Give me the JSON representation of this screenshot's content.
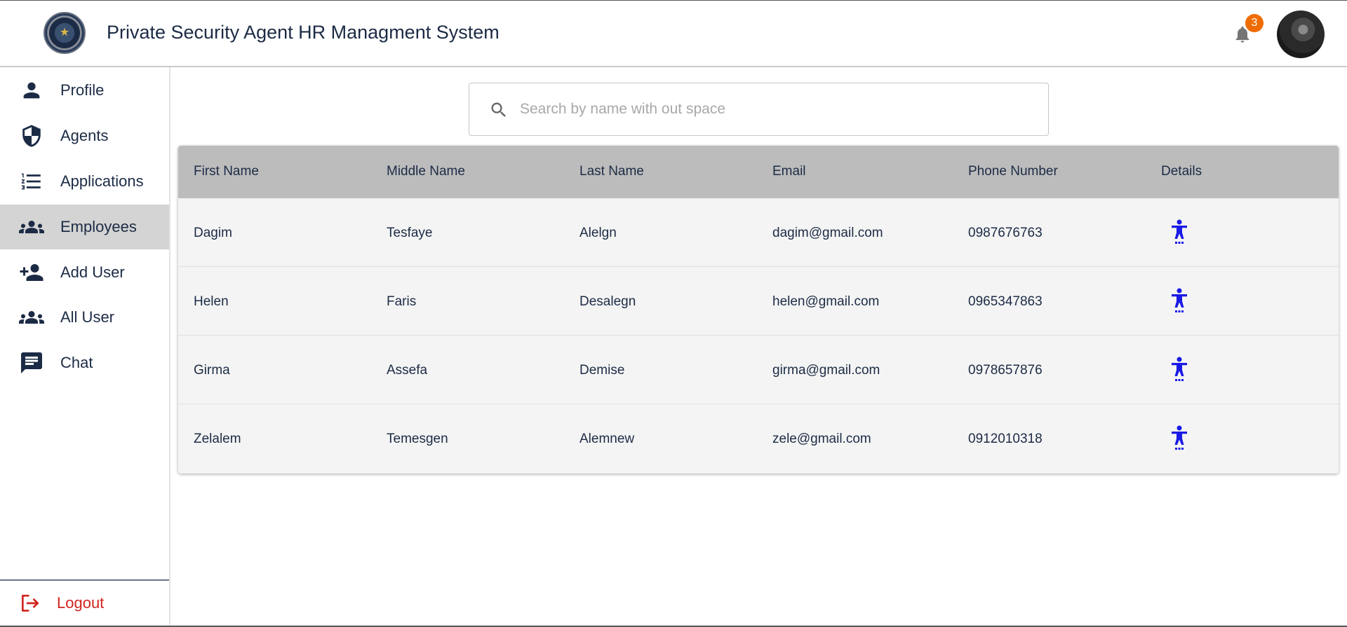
{
  "header": {
    "title": "Private Security Agent HR Managment System",
    "notifications_count": "3",
    "logo_icon": "badge-star-emblem",
    "avatar": "user-avatar-photo"
  },
  "sidebar": {
    "items": [
      {
        "label": "Profile",
        "icon": "person-icon",
        "active": false
      },
      {
        "label": "Agents",
        "icon": "shield-icon",
        "active": false
      },
      {
        "label": "Applications",
        "icon": "numbered-list-icon",
        "active": false
      },
      {
        "label": "Employees",
        "icon": "group-icon",
        "active": true
      },
      {
        "label": "Add User",
        "icon": "person-add-icon",
        "active": false
      },
      {
        "label": "All User",
        "icon": "group-icon",
        "active": false
      },
      {
        "label": "Chat",
        "icon": "chat-icon",
        "active": false
      }
    ],
    "logout_label": "Logout"
  },
  "search": {
    "placeholder": "Search by name with out space",
    "value": ""
  },
  "table": {
    "columns": [
      "First Name",
      "Middle Name",
      "Last Name",
      "Email",
      "Phone Number",
      "Details"
    ],
    "rows": [
      [
        "Dagim",
        "Tesfaye",
        "Alelgn",
        "dagim@gmail.com",
        "0987676763"
      ],
      [
        "Helen",
        "Faris",
        "Desalegn",
        "helen@gmail.com",
        "0965347863"
      ],
      [
        "Girma",
        "Assefa",
        "Demise",
        "girma@gmail.com",
        "0978657876"
      ],
      [
        "Zelalem",
        "Temesgen",
        "Alemnew",
        "zele@gmail.com",
        "0912010318"
      ]
    ],
    "details_icon": "accessibility-person-icon"
  },
  "colors": {
    "primary_text": "#1c2b45",
    "active_nav_bg": "#d4d4d4",
    "table_header_bg": "#bcbcbc",
    "details_icon": "#1a1ae6",
    "logout": "#d0251f",
    "badge": "#ef6c00"
  }
}
